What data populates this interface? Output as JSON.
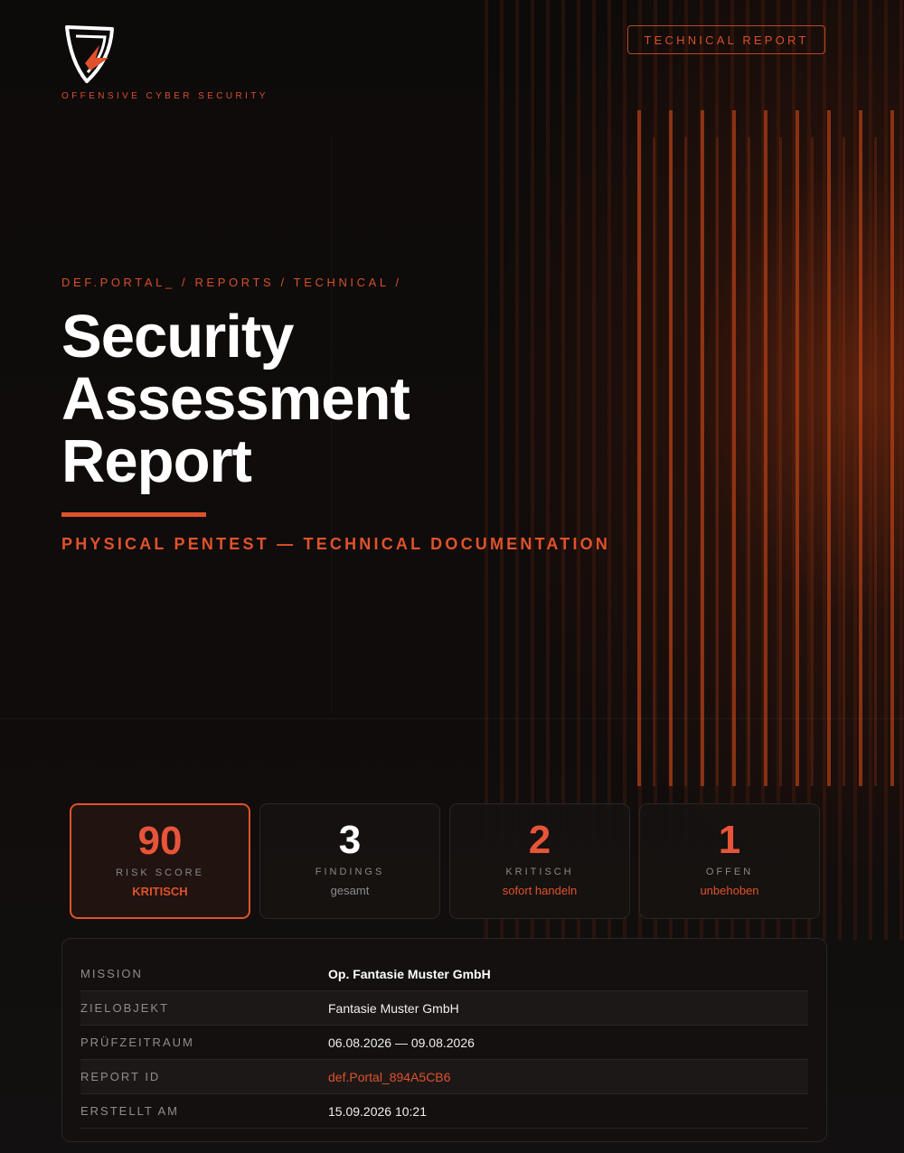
{
  "brand": {
    "tagline": "OFFENSIVE CYBER SECURITY",
    "logo_icon": "shield-logo-icon",
    "accent_color": "#e0522c"
  },
  "header": {
    "badge": "TECHNICAL REPORT"
  },
  "hero": {
    "breadcrumb": "DEF.PORTAL_ / REPORTS / TECHNICAL /",
    "title_lines": [
      "Security",
      "Assessment",
      "Report"
    ],
    "subtitle": "PHYSICAL PENTEST — TECHNICAL DOCUMENTATION"
  },
  "stats": [
    {
      "value": "90",
      "label": "RISK SCORE",
      "sub": "KRITISCH"
    },
    {
      "value": "3",
      "label": "FINDINGS",
      "sub": "gesamt"
    },
    {
      "value": "2",
      "label": "KRITISCH",
      "sub": "sofort handeln"
    },
    {
      "value": "1",
      "label": "OFFEN",
      "sub": "unbehoben"
    }
  ],
  "details": [
    {
      "key": "MISSION",
      "value": "Op. Fantasie Muster GmbH"
    },
    {
      "key": "ZIELOBJEKT",
      "value": "Fantasie Muster GmbH"
    },
    {
      "key": "PRÜFZEITRAUM",
      "value": "06.08.2026 — 09.08.2026"
    },
    {
      "key": "REPORT ID",
      "value": "def.Portal_894A5CB6"
    },
    {
      "key": "ERSTELLT AM",
      "value": "15.09.2026 10:21"
    }
  ]
}
